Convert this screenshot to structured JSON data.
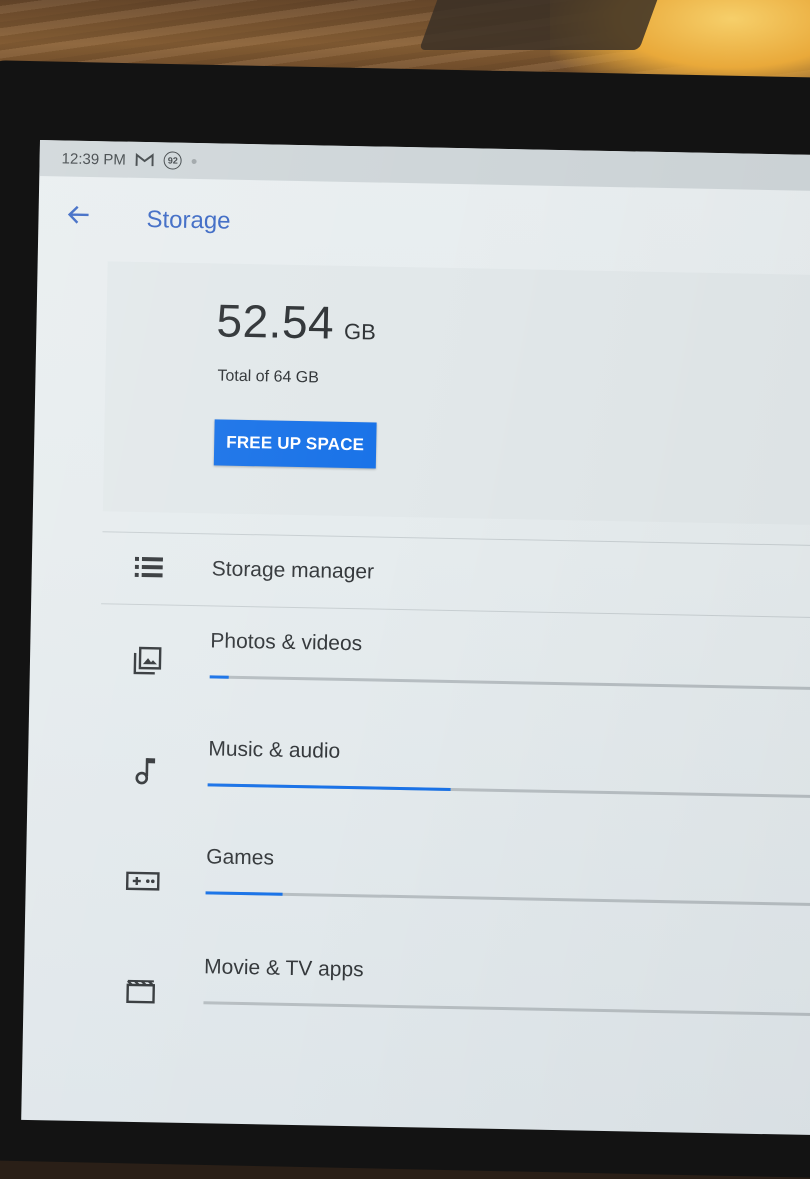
{
  "status_bar": {
    "time": "12:39 PM",
    "badge": "92"
  },
  "app_bar": {
    "title": "Storage"
  },
  "summary": {
    "used_value": "52.54",
    "used_unit": "GB",
    "total_text": "Total of 64 GB",
    "free_up_label": "FREE UP SPACE"
  },
  "storage_manager": {
    "label": "Storage manager"
  },
  "categories": [
    {
      "label": "Photos & videos",
      "icon": "photo-library-icon",
      "usage_fraction": 0.03
    },
    {
      "label": "Music & audio",
      "icon": "music-note-icon",
      "usage_fraction": 0.38
    },
    {
      "label": "Games",
      "icon": "gamepad-icon",
      "usage_fraction": 0.12
    },
    {
      "label": "Movie & TV apps",
      "icon": "movie-icon",
      "usage_fraction": 0.0
    }
  ],
  "colors": {
    "accent": "#1a73e8",
    "title": "#3b68c4"
  }
}
